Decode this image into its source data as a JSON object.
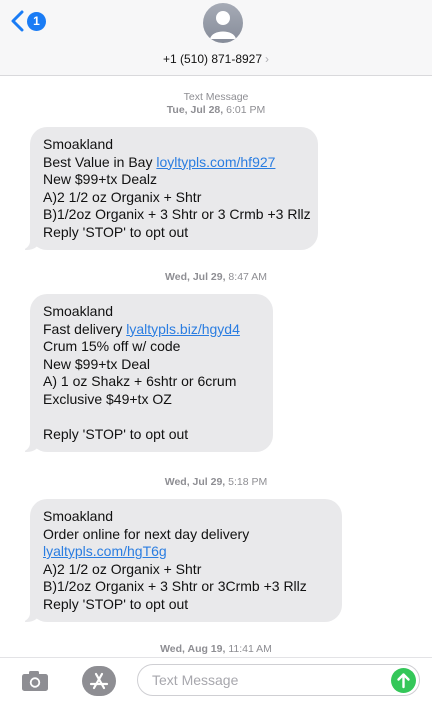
{
  "header": {
    "back_badge_count": "1",
    "contact_number": "+1 (510) 871-8927",
    "contact_chevron": "›"
  },
  "colors": {
    "accent": "#1a7cf5",
    "bubble_received": "#e9e9eb",
    "link": "#2a7de1",
    "send_button": "#34c759",
    "timestamp_text": "#8e8e93"
  },
  "icons": {
    "back": "chevron-left-icon",
    "avatar": "person-silhouette-icon",
    "camera": "camera-icon",
    "app_store": "app-store-icon",
    "send": "arrow-up-icon"
  },
  "thread": {
    "header_label": "Text Message",
    "timestamps": [
      {
        "day": "Tue, Jul 28,",
        "time": " 6:01 PM"
      },
      {
        "day": "Wed, Jul 29,",
        "time": " 8:47 AM"
      },
      {
        "day": "Wed, Jul 29,",
        "time": " 5:18 PM"
      },
      {
        "day": "Wed, Aug 19,",
        "time": " 11:41 AM"
      }
    ],
    "messages": [
      {
        "lines": [
          "Smoakland",
          "Best Value in Bay ",
          "New $99+tx Dealz",
          "A)2 1/2 oz Organix + Shtr",
          "B)1/2oz Organix + 3 Shtr or 3 Crmb +3 Rllz",
          "Reply 'STOP' to opt out"
        ],
        "link": "loyltypls.com/hf927"
      },
      {
        "lines": [
          "Smoakland",
          "Fast delivery ",
          "Crum 15% off w/ code",
          "New $99+tx Deal",
          "A) 1 oz Shakz + 6shtr or 6crum",
          "Exclusive $49+tx OZ",
          "",
          "Reply 'STOP' to opt out"
        ],
        "link": "lyaltypls.biz/hgyd4"
      },
      {
        "lines": [
          "Smoakland",
          "Order online for next day delivery",
          "A)2 1/2 oz Organix + Shtr",
          "B)1/2oz Organix + 3 Shtr or 3Crmb +3 Rllz",
          "Reply 'STOP' to opt out"
        ],
        "link": "lyaltypls.com/hgT6g"
      }
    ]
  },
  "compose": {
    "placeholder": "Text Message",
    "value": ""
  }
}
